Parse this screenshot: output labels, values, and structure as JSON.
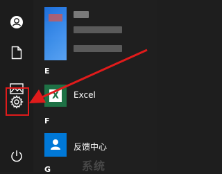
{
  "sections": {
    "e_letter": "E",
    "f_letter": "F",
    "g_letter": "G"
  },
  "apps": {
    "excel_label": "Excel",
    "excel_icon_letter": "X",
    "feedback_label": "反馈中心"
  },
  "rail_icons": [
    "user-icon",
    "document-icon",
    "pictures-icon",
    "gear-icon",
    "power-icon"
  ],
  "colors": {
    "highlight": "#e01b1b",
    "arrow": "#e01b1b",
    "excel_green": "#1e7145",
    "feedback_blue": "#0078d7"
  },
  "watermark": "系统"
}
